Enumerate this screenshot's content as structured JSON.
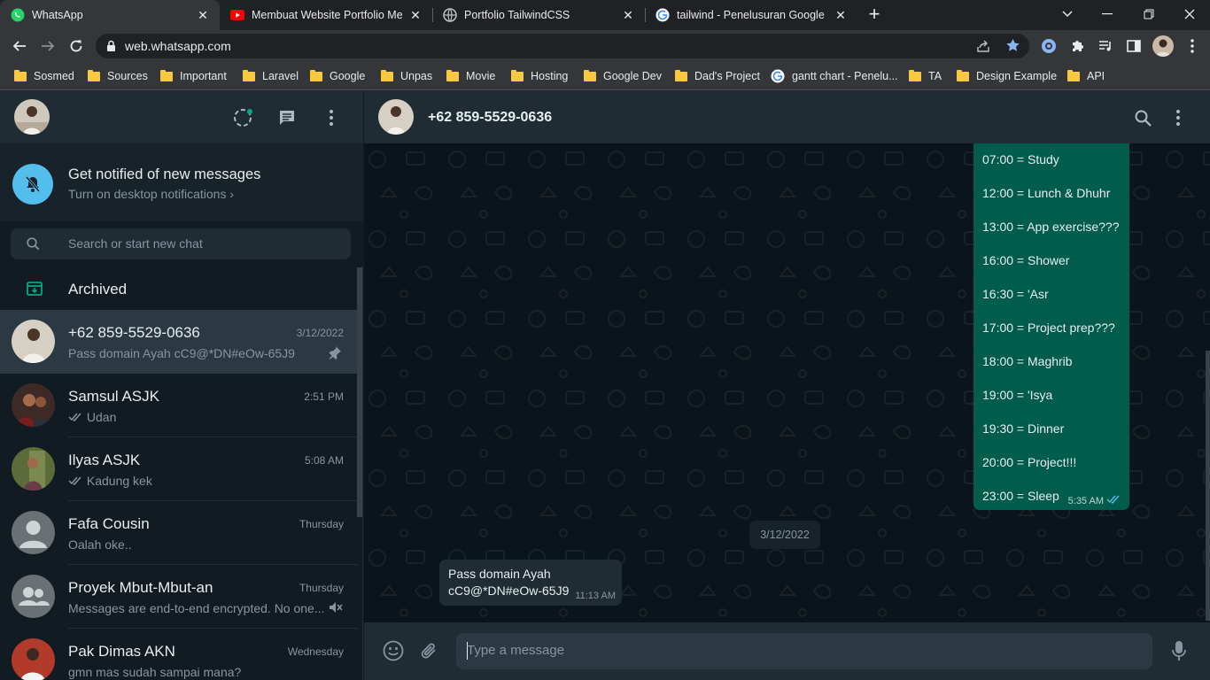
{
  "browser": {
    "tabs": [
      {
        "title": "WhatsApp",
        "active": true
      },
      {
        "title": "Membuat Website Portfolio Men",
        "active": false
      },
      {
        "title": "Portfolio TailwindCSS",
        "active": false
      },
      {
        "title": "tailwind - Penelusuran Google",
        "active": false
      }
    ],
    "url": "web.whatsapp.com",
    "bookmarks": [
      "Sosmed",
      "Sources",
      "Important",
      "Laravel",
      "Google",
      "Unpas",
      "Movie",
      "Hosting",
      "Google Dev",
      "Dad's Project",
      "gantt chart - Penelu...",
      "TA",
      "Design Example",
      "API"
    ]
  },
  "sidebar": {
    "notification": {
      "title": "Get notified of new messages",
      "subtitle": "Turn on desktop notifications"
    },
    "search_placeholder": "Search or start new chat",
    "archived_label": "Archived",
    "chats": [
      {
        "name": "+62 859-5529-0636",
        "time": "3/12/2022",
        "preview": "Pass domain Ayah cC9@*DN#eOw-65J9",
        "pinned": true,
        "selected": true
      },
      {
        "name": "Samsul ASJK",
        "time": "2:51 PM",
        "preview": "Udan",
        "read": true
      },
      {
        "name": "Ilyas ASJK",
        "time": "5:08 AM",
        "preview": "Kadung kek",
        "read": true
      },
      {
        "name": "Fafa Cousin",
        "time": "Thursday",
        "preview": "Oalah oke.."
      },
      {
        "name": "Proyek Mbut-Mbut-an",
        "time": "Thursday",
        "preview": "Messages are end-to-end encrypted. No one...",
        "muted": true
      },
      {
        "name": "Pak Dimas AKN",
        "time": "Wednesday",
        "preview": "gmn mas sudah sampai mana?"
      }
    ]
  },
  "conversation": {
    "contact_name": "+62 859-5529-0636",
    "schedule": [
      "07:00 = Study",
      "12:00 = Lunch & Dhuhr",
      "13:00 = App exercise???",
      "16:00 = Shower",
      "16:30 = 'Asr",
      "17:00 = Project prep???",
      "18:00 = Maghrib",
      "19:00 = 'Isya",
      "19:30 = Dinner",
      "20:00 = Project!!!",
      "23:00 = Sleep"
    ],
    "outgoing_time": "5:35 AM",
    "date_chip": "3/12/2022",
    "incoming": {
      "line1": "Pass domain Ayah",
      "line2": "cC9@*DN#eOw-65J9",
      "time": "11:13 AM"
    },
    "composer_placeholder": "Type a message"
  },
  "colors": {
    "accent": "#00a884",
    "outgoing_bubble": "#005c4b",
    "incoming_bubble": "#202c33",
    "notification_icon": "#53bdeb"
  }
}
